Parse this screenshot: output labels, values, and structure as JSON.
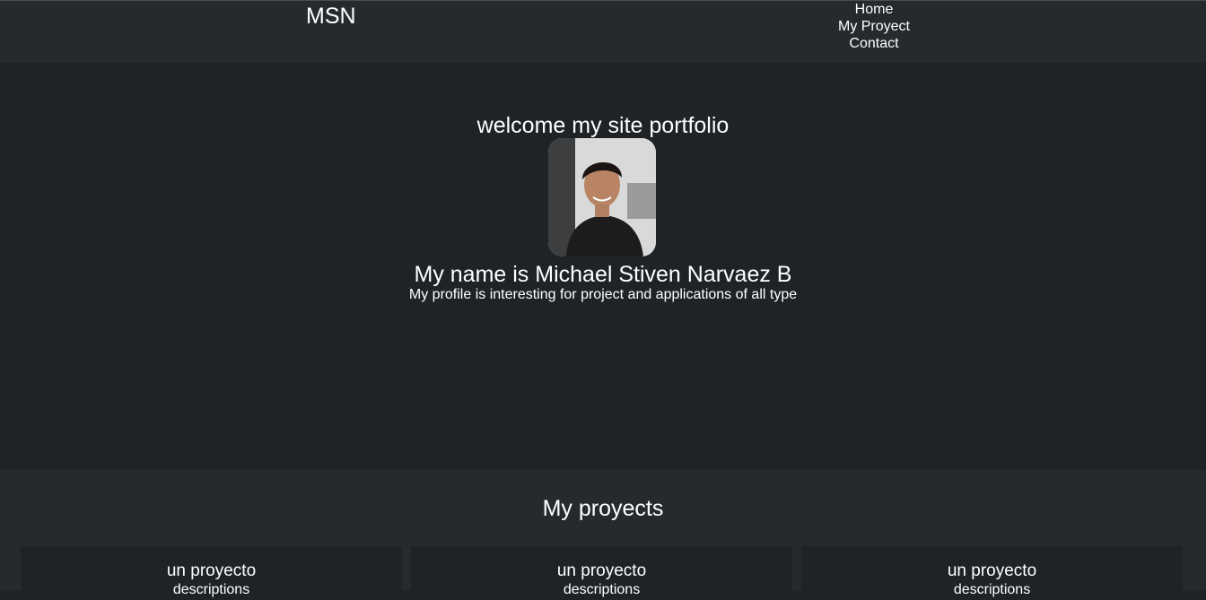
{
  "header": {
    "brand": "MSN",
    "nav": [
      "Home",
      "My Proyect",
      "Contact"
    ]
  },
  "hero": {
    "title": "welcome my site portfolio",
    "name": "My name is Michael Stiven Narvaez B",
    "subtitle": "My profile is interesting for project and applications of all type"
  },
  "projects": {
    "title": "My proyects",
    "cards": [
      {
        "title": "un proyecto",
        "description": "descriptions"
      },
      {
        "title": "un proyecto",
        "description": "descriptions"
      },
      {
        "title": "un proyecto",
        "description": "descriptions"
      }
    ]
  },
  "colors": {
    "background": "#1f2327",
    "header": "#262a2e",
    "text": "#ffffff"
  }
}
